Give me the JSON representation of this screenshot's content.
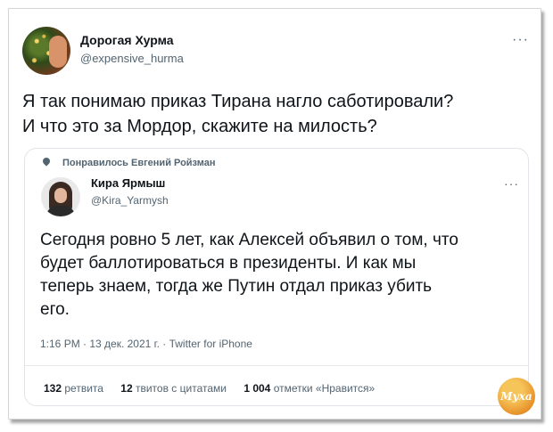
{
  "tweet": {
    "author_name": "Дорогая Хурма",
    "author_handle": "@expensive_hurma",
    "more_label": "···",
    "text_lines": [
      "Я так понимаю приказ Тирана нагло саботировали?",
      "И что это за Мордор, скажите на милость?"
    ]
  },
  "quote": {
    "liked_by": "Понравилось Евгений Ройзман",
    "author_name": "Кира Ярмыш",
    "author_handle": "@Kira_Yarmysh",
    "more_label": "···",
    "text_lines": [
      "Сегодня ровно 5 лет, как Алексей объявил о том, что",
      "будет баллотироваться в президенты. И как мы",
      "теперь знаем, тогда же Путин отдал приказ убить",
      "его."
    ],
    "meta": "1:16 PM · 13 дек. 2021 г. · Twitter for iPhone",
    "stats": {
      "retweets_num": "132",
      "retweets_label": "ретвита",
      "quotes_num": "12",
      "quotes_label": "твитов с цитатами",
      "likes_num": "1 004",
      "likes_label": "отметки «Нравится»"
    }
  },
  "watermark": {
    "text": "Муха"
  }
}
